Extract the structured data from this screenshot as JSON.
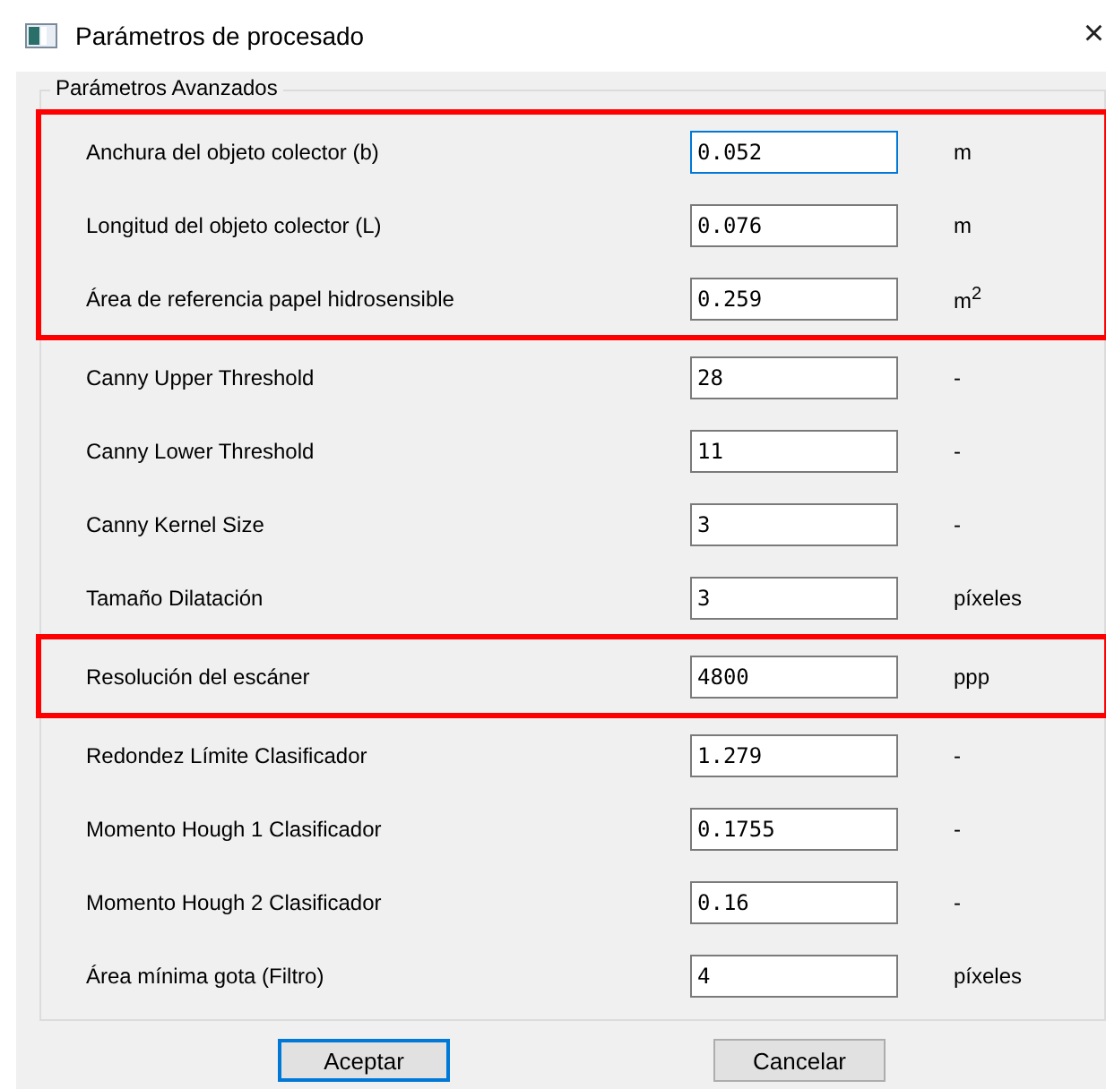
{
  "window": {
    "title": "Parámetros de procesado",
    "close": "×"
  },
  "group": {
    "title": "Parámetros Avanzados",
    "sections": [
      {
        "highlighted": true,
        "rows": [
          {
            "label": "Anchura del objeto colector (b)",
            "value": "0.052",
            "focused": true,
            "unit": "m"
          },
          {
            "label": "Longitud del objeto colector (L)",
            "value": "0.076",
            "focused": false,
            "unit": "m"
          },
          {
            "label": "Área de referencia papel hidrosensible",
            "value": "0.259",
            "focused": false,
            "unit": "m$^{2}$"
          }
        ]
      },
      {
        "highlighted": false,
        "rows": [
          {
            "label": "Canny Upper Threshold",
            "value": "28",
            "focused": false,
            "unit": "-"
          },
          {
            "label": "Canny Lower Threshold",
            "value": "11",
            "focused": false,
            "unit": "-"
          },
          {
            "label": "Canny Kernel Size",
            "value": "3",
            "focused": false,
            "unit": "-"
          },
          {
            "label": "Tamaño Dilatación",
            "value": "3",
            "focused": false,
            "unit": "píxeles"
          }
        ]
      },
      {
        "highlighted": true,
        "rows": [
          {
            "label": "Resolución del escáner",
            "value": "4800",
            "focused": false,
            "unit": "ppp"
          }
        ]
      },
      {
        "highlighted": false,
        "rows": [
          {
            "label": "Redondez Límite Clasificador",
            "value": "1.279",
            "focused": false,
            "unit": "-"
          },
          {
            "label": "Momento Hough 1 Clasificador",
            "value": "0.1755",
            "focused": false,
            "unit": "-"
          },
          {
            "label": "Momento Hough 2 Clasificador",
            "value": "0.16",
            "focused": false,
            "unit": "-"
          },
          {
            "label": "Área mínima gota (Filtro)",
            "value": "4",
            "focused": false,
            "unit": "píxeles"
          }
        ]
      }
    ]
  },
  "buttons": [
    {
      "label": "Aceptar",
      "default": true
    },
    {
      "label": "Cancelar",
      "default": false
    }
  ]
}
